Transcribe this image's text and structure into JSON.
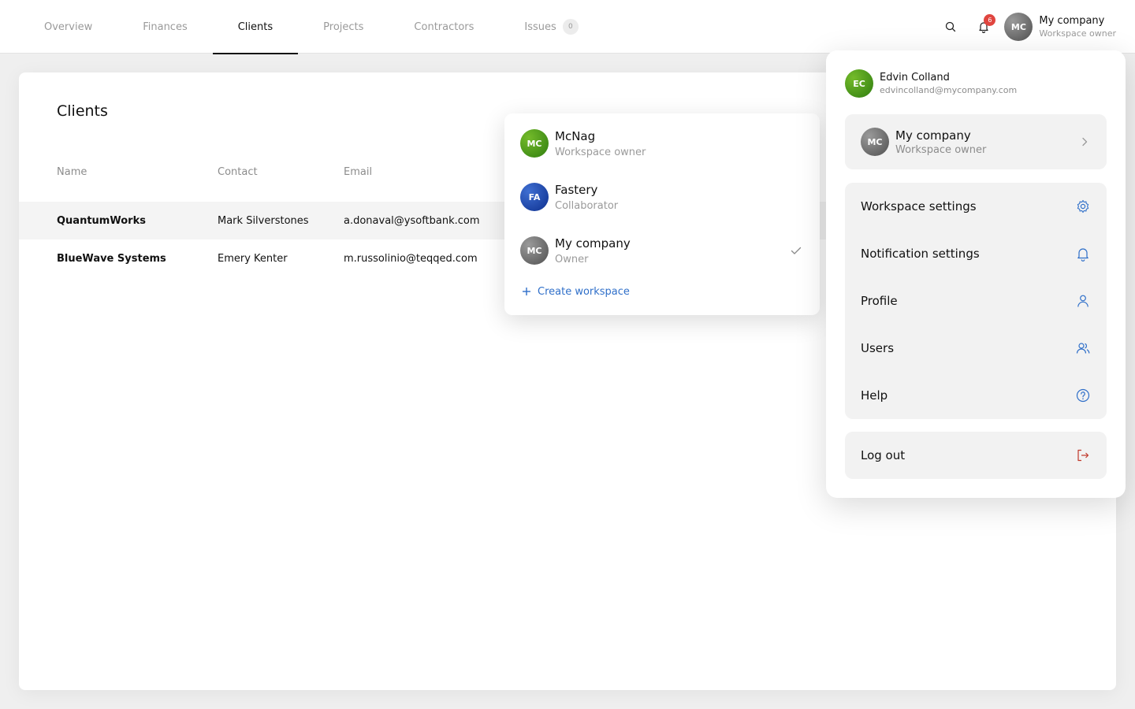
{
  "nav": {
    "tabs": [
      {
        "label": "Overview"
      },
      {
        "label": "Finances"
      },
      {
        "label": "Clients"
      },
      {
        "label": "Projects"
      },
      {
        "label": "Contractors"
      },
      {
        "label": "Issues",
        "badge": "0"
      }
    ],
    "active_tab": "Clients",
    "notification_count": "6",
    "account": {
      "initials": "MC",
      "name": "My company",
      "role": "Workspace owner"
    }
  },
  "page": {
    "title": "Clients",
    "columns": [
      "Name",
      "Contact",
      "Email"
    ],
    "rows": [
      {
        "name": "QuantumWorks",
        "contact": "Mark Silverstones",
        "email": "a.donaval@ysoftbank.com"
      },
      {
        "name": "BlueWave Systems",
        "contact": "Emery Kenter",
        "email": "m.russolinio@teqqed.com"
      }
    ]
  },
  "workspace_menu": {
    "items": [
      {
        "initials": "MC",
        "name": "McNag",
        "role": "Workspace owner"
      },
      {
        "initials": "FA",
        "name": "Fastery",
        "role": "Collaborator"
      },
      {
        "initials": "MC",
        "name": "My company",
        "role": "Owner",
        "selected": true
      }
    ],
    "create_label": "Create workspace"
  },
  "profile_panel": {
    "user": {
      "initials": "EC",
      "name": "Edvin Colland",
      "email": "edvincolland@mycompany.com"
    },
    "company": {
      "initials": "MC",
      "name": "My company",
      "role": "Workspace owner"
    },
    "menu": [
      {
        "label": "Workspace settings",
        "icon": "gear-icon"
      },
      {
        "label": "Notification settings",
        "icon": "bell-icon"
      },
      {
        "label": "Profile",
        "icon": "user-icon"
      },
      {
        "label": "Users",
        "icon": "users-icon"
      },
      {
        "label": "Help",
        "icon": "help-icon"
      }
    ],
    "logout_label": "Log out"
  },
  "colors": {
    "accent": "#2f6fc9",
    "logout_icon": "#c0392b",
    "notification": "#e0453f"
  }
}
